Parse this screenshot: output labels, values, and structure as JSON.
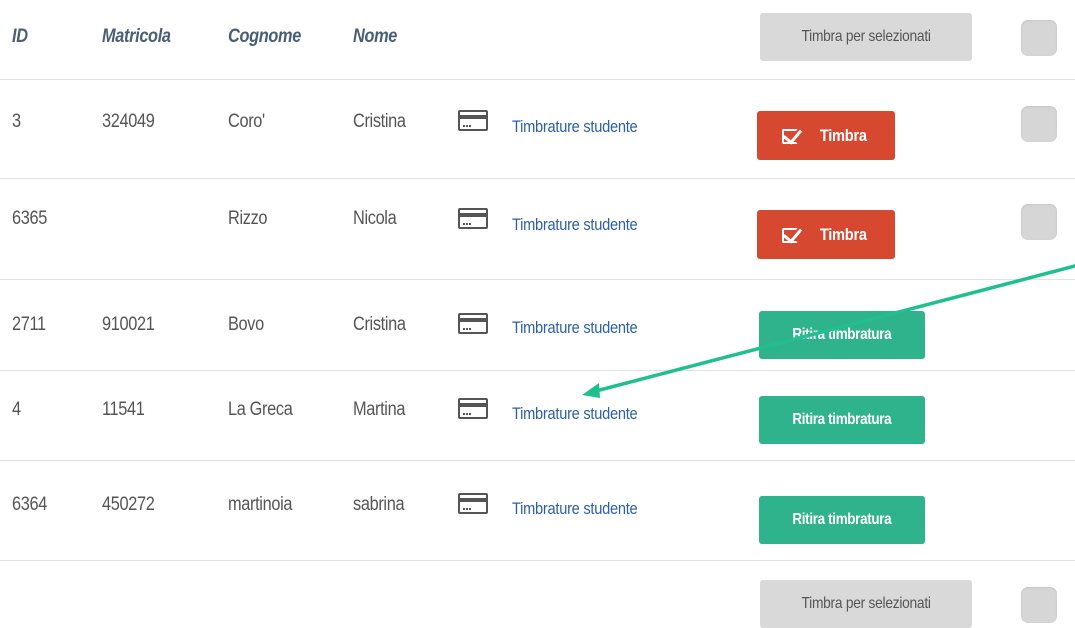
{
  "header": {
    "id": "ID",
    "matricola": "Matricola",
    "cognome": "Cognome",
    "nome": "Nome",
    "bulk_label": "Timbra per selezionati"
  },
  "rows": [
    {
      "id": "3",
      "matricola": "324049",
      "cognome": "Coro'",
      "nome": "Cristina",
      "link": "Timbrature studente",
      "action": "Timbra"
    },
    {
      "id": "6365",
      "matricola": "",
      "cognome": "Rizzo",
      "nome": "Nicola",
      "link": "Timbrature studente",
      "action": "Timbra"
    },
    {
      "id": "2711",
      "matricola": "910021",
      "cognome": "Bovo",
      "nome": "Cristina",
      "link": "Timbrature studente",
      "action": "Ritira timbratura"
    },
    {
      "id": "4",
      "matricola": "11541",
      "cognome": "La Greca",
      "nome": "Martina",
      "link": "Timbrature studente",
      "action": "Ritira timbratura"
    },
    {
      "id": "6364",
      "matricola": "450272",
      "cognome": "martinoia",
      "nome": "sabrina",
      "link": "Timbrature studente",
      "action": "Ritira timbratura"
    }
  ],
  "footer": {
    "bulk_label": "Timbra per selezionati"
  },
  "colors": {
    "timbra": "#d64830",
    "ritira": "#2fb38c",
    "link": "#2b5fa8",
    "header_text": "#4a5d79",
    "annotation_arrow": "#1fbf8f"
  },
  "icons": {
    "card": "credit-card-icon",
    "check": "check-square-icon"
  }
}
